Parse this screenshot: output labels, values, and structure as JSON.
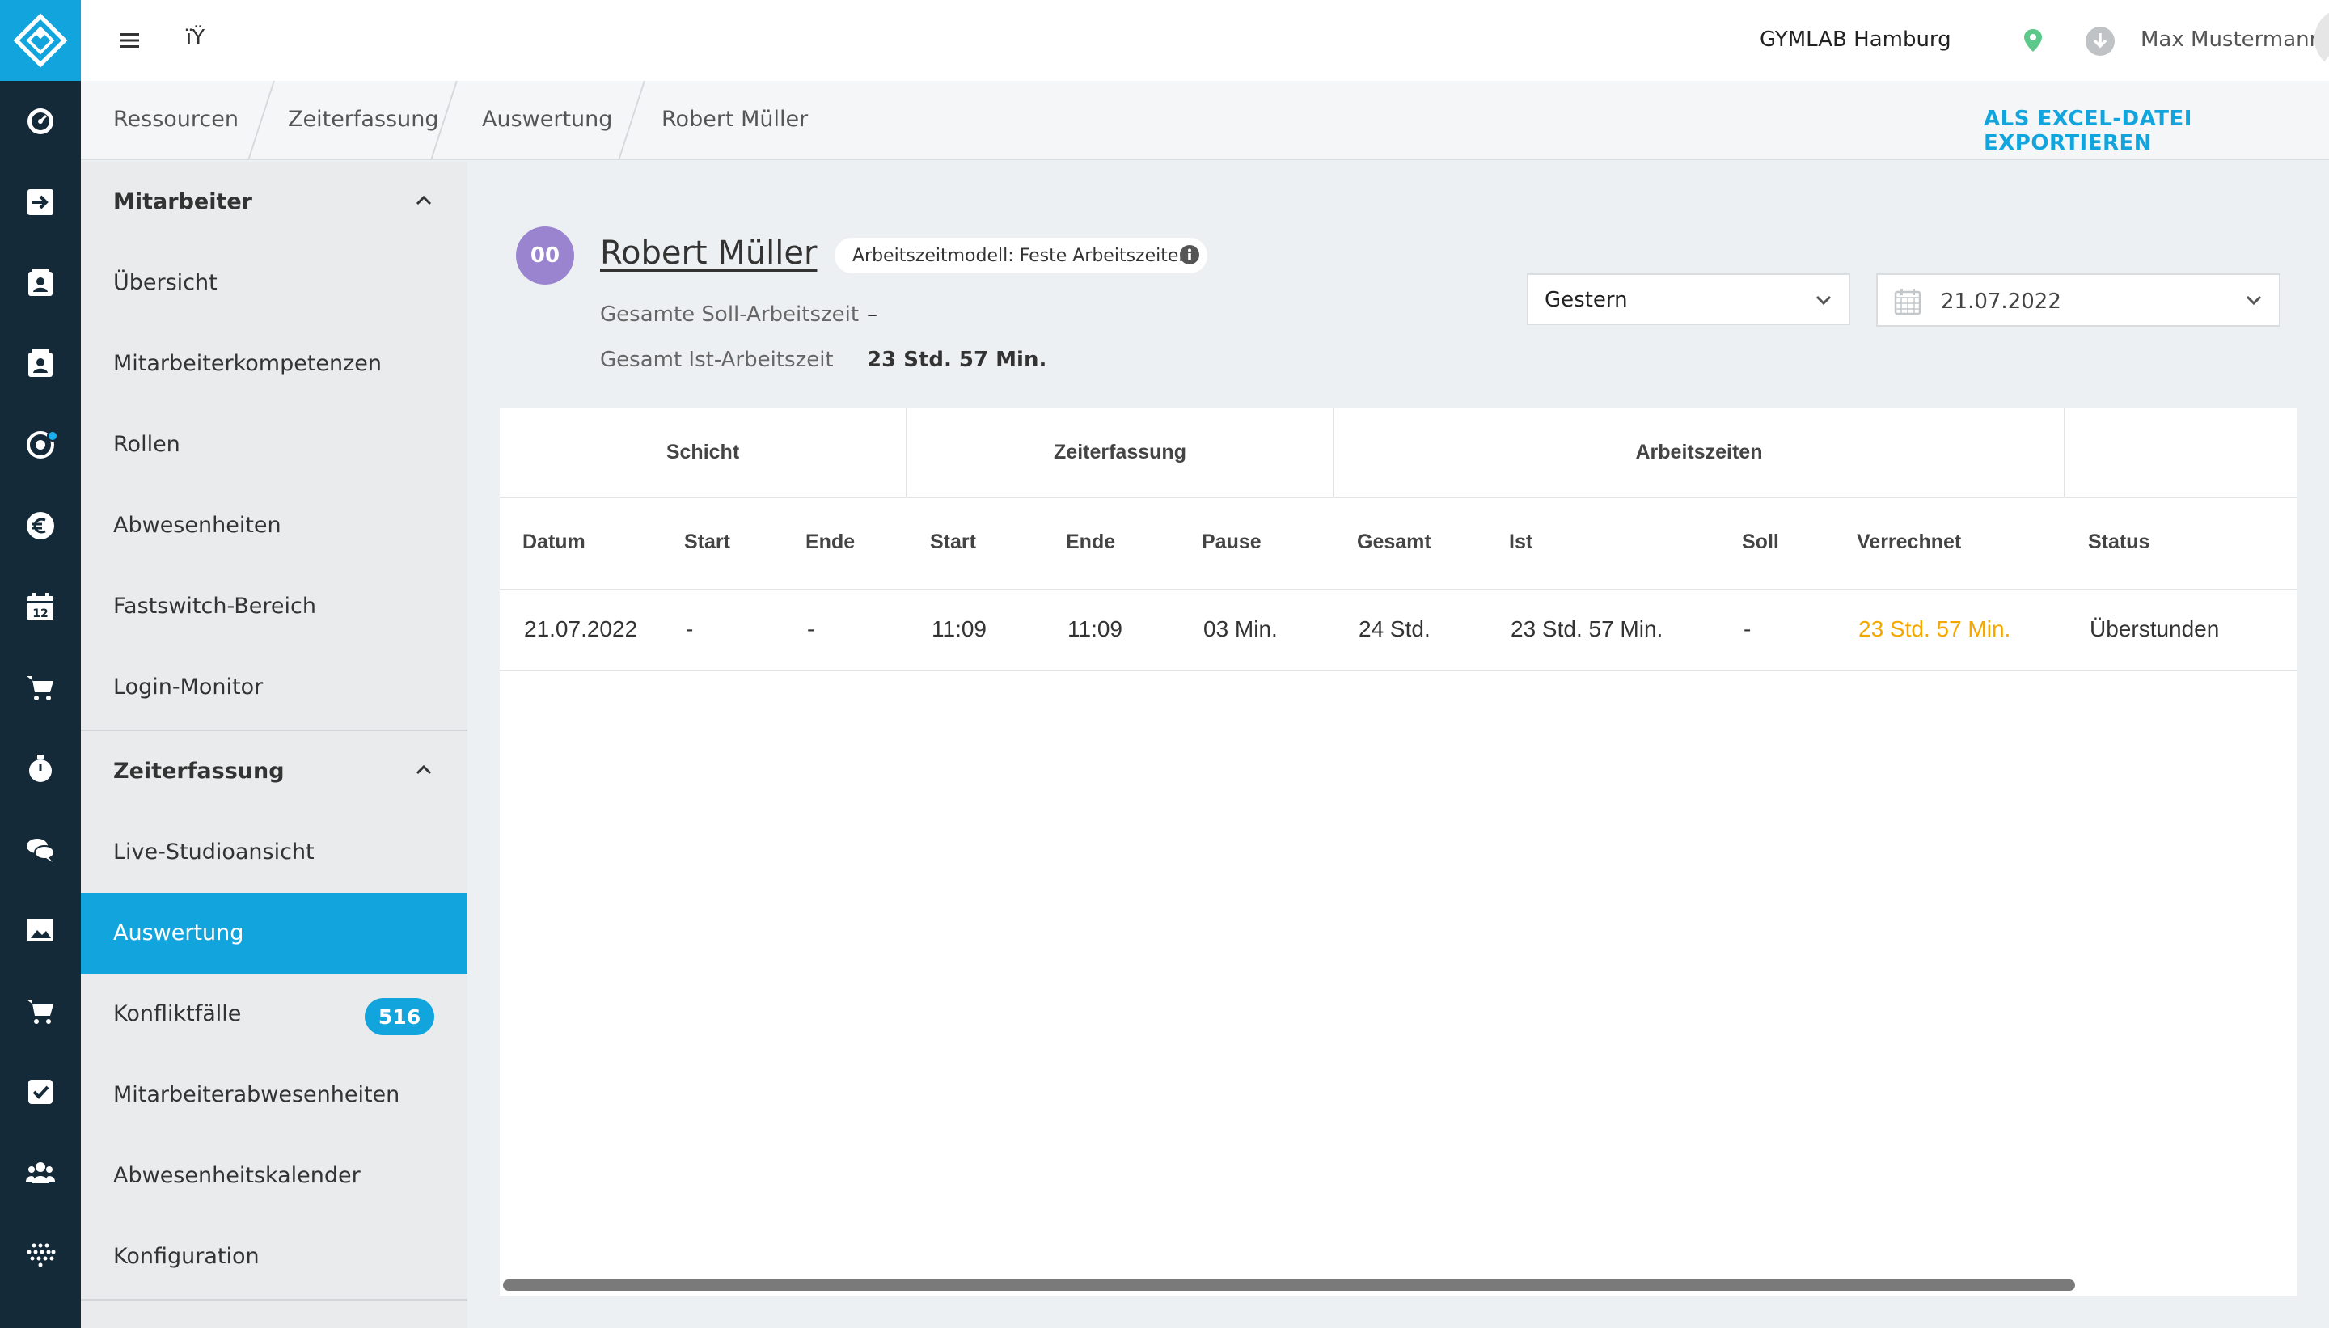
{
  "topbar": {
    "menu_icon": "hamburger-icon",
    "glyph": "ïŸ",
    "studio_name": "GYMLAB Hamburg",
    "user_name": "Max Mustermann"
  },
  "breadcrumb": [
    "Ressourcen",
    "Zeiterfassung",
    "Auswertung",
    "Robert Müller"
  ],
  "export_label": "ALS EXCEL-DATEI EXPORTIEREN",
  "sidebar": {
    "section1": {
      "title": "Mitarbeiter",
      "items": [
        "Übersicht",
        "Mitarbeiterkompetenzen",
        "Rollen",
        "Abwesenheiten",
        "Fastswitch-Bereich",
        "Login-Monitor"
      ]
    },
    "section2": {
      "title": "Zeiterfassung",
      "items": [
        "Live-Studioansicht",
        "Auswertung",
        "Konfliktfälle",
        "Mitarbeiterabwesenheiten",
        "Abwesenheitskalender",
        "Konfiguration"
      ],
      "active": "Auswertung",
      "badge": "516"
    }
  },
  "employee": {
    "initials": "00",
    "name": "Robert Müller",
    "model": "Arbeitszeitmodell: Feste Arbeitszeiten",
    "soll_label": "Gesamte Soll-Arbeitszeit",
    "soll_value": "–",
    "ist_label": "Gesamt Ist-Arbeitszeit",
    "ist_value": "23 Std. 57 Min."
  },
  "filters": {
    "period": "Gestern",
    "date": "21.07.2022"
  },
  "table": {
    "groups": [
      "Schicht",
      "Zeiterfassung",
      "Arbeitszeiten"
    ],
    "columns": [
      "Datum",
      "Start",
      "Ende",
      "Start",
      "Ende",
      "Pause",
      "Gesamt",
      "Ist",
      "Soll",
      "Verrechnet",
      "Status"
    ],
    "rows": [
      [
        "21.07.2022",
        "-",
        "-",
        "11:09",
        "11:09",
        "03 Min.",
        "24 Std.",
        "23 Std. 57 Min.",
        "-",
        "23 Std. 57 Min.",
        "Überstunden"
      ]
    ]
  },
  "colors": {
    "accent": "#12a5dd",
    "rail": "#152a38",
    "highlight_value": "#f5a700",
    "avatar": "#9a84d0"
  }
}
